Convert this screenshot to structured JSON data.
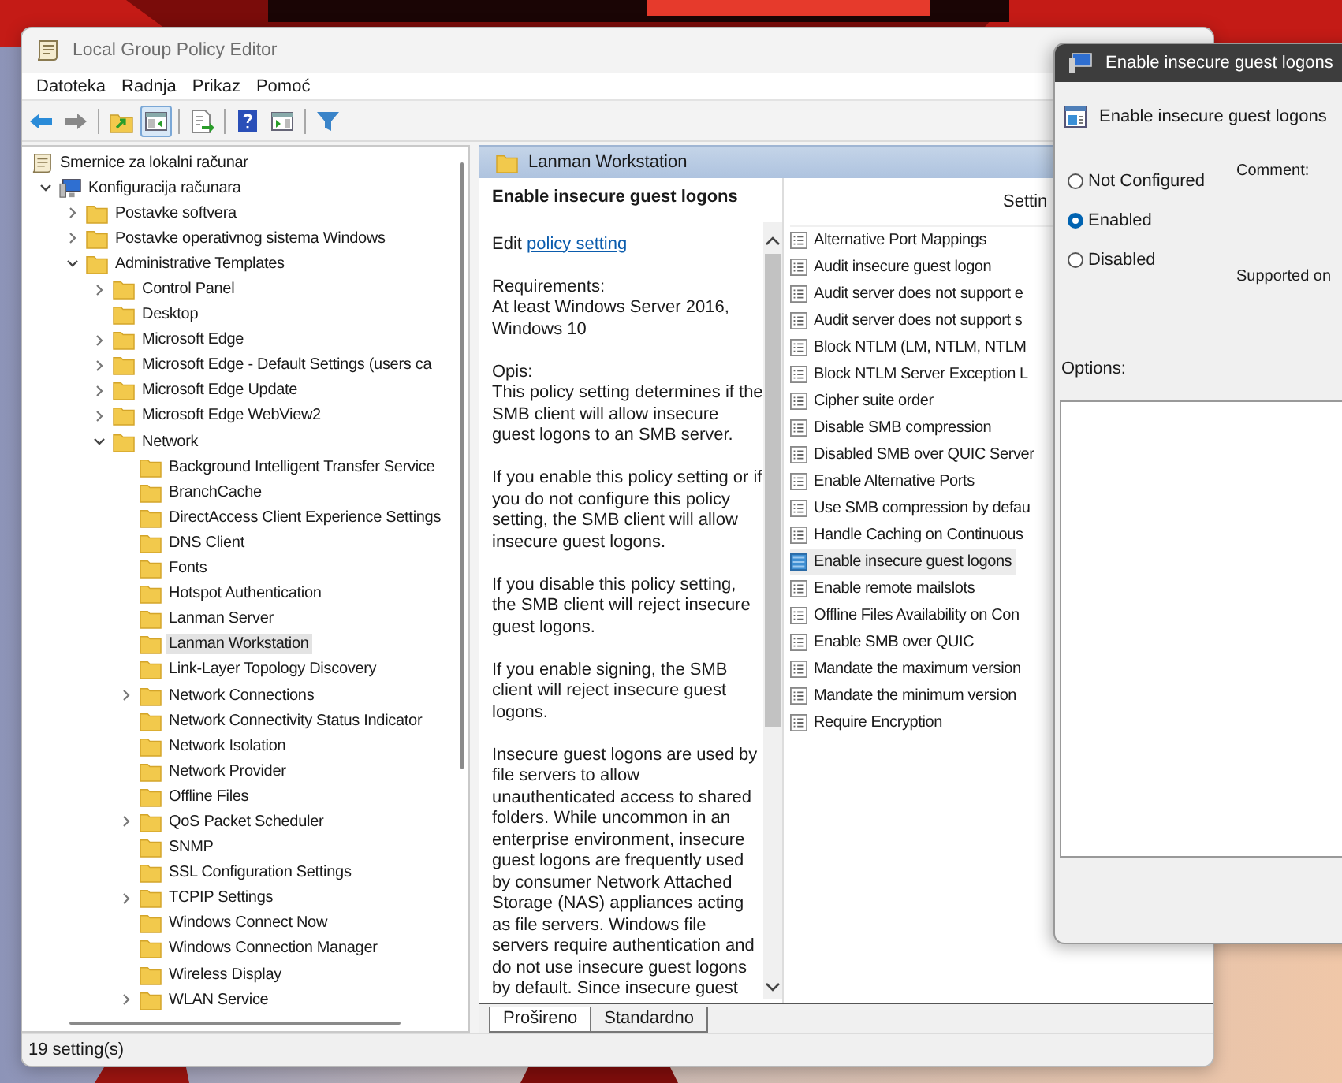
{
  "window": {
    "title": "Local Group Policy Editor"
  },
  "menu": [
    "Datoteka",
    "Radnja",
    "Prikaz",
    "Pomoć"
  ],
  "toolbar": [
    [
      {
        "kind": "back",
        "pressed": false
      },
      {
        "kind": "forward",
        "pressed": false
      }
    ],
    [
      {
        "kind": "up-folder",
        "pressed": false
      },
      {
        "kind": "show-tree",
        "pressed": true
      }
    ],
    [
      {
        "kind": "export",
        "pressed": false
      }
    ],
    [
      {
        "kind": "help",
        "pressed": false
      },
      {
        "kind": "action-pane",
        "pressed": false
      }
    ],
    [
      {
        "kind": "filter",
        "pressed": false
      }
    ]
  ],
  "tree": [
    {
      "label": "Smernice za lokalni računar",
      "kind": "policy-root",
      "selected": false,
      "children": [
        {
          "label": "Konfiguracija računara",
          "kind": "computer",
          "selected": false,
          "expanded": true,
          "children": [
            {
              "label": "Postavke softvera",
              "kind": "folder",
              "selected": false,
              "expanded": false
            },
            {
              "label": "Postavke operativnog sistema Windows",
              "kind": "folder",
              "selected": false,
              "expanded": false
            },
            {
              "label": "Administrative Templates",
              "kind": "folder",
              "selected": false,
              "expanded": true,
              "children": [
                {
                  "label": "Control Panel",
                  "kind": "folder",
                  "selected": false,
                  "expanded": false
                },
                {
                  "label": "Desktop",
                  "kind": "folder",
                  "selected": false
                },
                {
                  "label": "Microsoft Edge",
                  "kind": "folder",
                  "selected": false,
                  "expanded": false
                },
                {
                  "label": "Microsoft Edge - Default Settings (users ca",
                  "kind": "folder",
                  "selected": false,
                  "expanded": false
                },
                {
                  "label": "Microsoft Edge Update",
                  "kind": "folder",
                  "selected": false,
                  "expanded": false
                },
                {
                  "label": "Microsoft Edge WebView2",
                  "kind": "folder",
                  "selected": false,
                  "expanded": false
                },
                {
                  "label": "Network",
                  "kind": "folder",
                  "selected": false,
                  "expanded": true,
                  "children": [
                    {
                      "label": "Background Intelligent Transfer Service",
                      "kind": "folder",
                      "selected": false
                    },
                    {
                      "label": "BranchCache",
                      "kind": "folder",
                      "selected": false
                    },
                    {
                      "label": "DirectAccess Client Experience Settings",
                      "kind": "folder",
                      "selected": false
                    },
                    {
                      "label": "DNS Client",
                      "kind": "folder",
                      "selected": false
                    },
                    {
                      "label": "Fonts",
                      "kind": "folder",
                      "selected": false
                    },
                    {
                      "label": "Hotspot Authentication",
                      "kind": "folder",
                      "selected": false
                    },
                    {
                      "label": "Lanman Server",
                      "kind": "folder",
                      "selected": false
                    },
                    {
                      "label": "Lanman Workstation",
                      "kind": "folder",
                      "selected": true
                    },
                    {
                      "label": "Link-Layer Topology Discovery",
                      "kind": "folder",
                      "selected": false
                    },
                    {
                      "label": "Network Connections",
                      "kind": "folder",
                      "selected": false,
                      "expanded": false
                    },
                    {
                      "label": "Network Connectivity Status Indicator",
                      "kind": "folder",
                      "selected": false
                    },
                    {
                      "label": "Network Isolation",
                      "kind": "folder",
                      "selected": false
                    },
                    {
                      "label": "Network Provider",
                      "kind": "folder",
                      "selected": false
                    },
                    {
                      "label": "Offline Files",
                      "kind": "folder",
                      "selected": false
                    },
                    {
                      "label": "QoS Packet Scheduler",
                      "kind": "folder",
                      "selected": false,
                      "expanded": false
                    },
                    {
                      "label": "SNMP",
                      "kind": "folder",
                      "selected": false
                    },
                    {
                      "label": "SSL Configuration Settings",
                      "kind": "folder",
                      "selected": false
                    },
                    {
                      "label": "TCPIP Settings",
                      "kind": "folder",
                      "selected": false,
                      "expanded": false
                    },
                    {
                      "label": "Windows Connect Now",
                      "kind": "folder",
                      "selected": false
                    },
                    {
                      "label": "Windows Connection Manager",
                      "kind": "folder",
                      "selected": false
                    },
                    {
                      "label": "Wireless Display",
                      "kind": "folder",
                      "selected": false
                    },
                    {
                      "label": "WLAN Service",
                      "kind": "folder",
                      "selected": false,
                      "expanded": false
                    }
                  ]
                }
              ]
            }
          ]
        }
      ]
    }
  ],
  "details": {
    "header": "Lanman Workstation",
    "title": "Enable insecure guest logons",
    "edit_prefix": "Edit",
    "edit_link": "policy setting",
    "requirements_label": "Requirements:",
    "requirements": "At least Windows Server 2016, Windows 10",
    "description_label": "Opis:",
    "paragraphs": [
      "This policy setting determines if the SMB client will allow insecure guest logons to an SMB server.",
      "If you enable this policy setting or if you do not configure this policy setting, the SMB client will allow insecure guest logons.",
      "If you disable this policy setting, the SMB client will reject insecure guest logons.",
      "If you enable signing, the SMB client will reject insecure guest logons.",
      "Insecure guest logons are used by file servers to allow unauthenticated access to shared folders. While uncommon in an enterprise environment, insecure guest logons are frequently used by consumer Network Attached Storage (NAS) appliances acting as file servers. Windows file servers require authentication and do not use insecure guest logons by default. Since insecure guest"
    ]
  },
  "settings": {
    "column_header": "Settin",
    "items": [
      {
        "name": "Alternative Port Mappings",
        "selected": false
      },
      {
        "name": "Audit insecure guest logon",
        "selected": false
      },
      {
        "name": "Audit server does not support e",
        "selected": false
      },
      {
        "name": "Audit server does not support s",
        "selected": false
      },
      {
        "name": "Block NTLM (LM, NTLM, NTLM",
        "selected": false
      },
      {
        "name": "Block NTLM Server Exception L",
        "selected": false
      },
      {
        "name": "Cipher suite order",
        "selected": false
      },
      {
        "name": "Disable SMB compression",
        "selected": false
      },
      {
        "name": "Disabled SMB over QUIC Server",
        "selected": false
      },
      {
        "name": "Enable Alternative Ports",
        "selected": false
      },
      {
        "name": "Use SMB compression by defau",
        "selected": false
      },
      {
        "name": "Handle Caching on Continuous",
        "selected": false
      },
      {
        "name": "Enable insecure guest logons",
        "selected": true
      },
      {
        "name": "Enable remote mailslots",
        "selected": false
      },
      {
        "name": "Offline Files Availability on Con",
        "selected": false
      },
      {
        "name": "Enable SMB over QUIC",
        "selected": false
      },
      {
        "name": "Mandate the maximum version",
        "selected": false
      },
      {
        "name": "Mandate the minimum version",
        "selected": false
      },
      {
        "name": "Require Encryption",
        "selected": false
      }
    ]
  },
  "tabs": [
    {
      "label": "Prošireno",
      "selected": true
    },
    {
      "label": "Standardno",
      "selected": false
    }
  ],
  "status_bar": "19 setting(s)",
  "dialog": {
    "title": "Enable insecure guest logons",
    "policy_name": "Enable insecure guest logons",
    "options": [
      {
        "label": "Not Configured",
        "selected": false
      },
      {
        "label": "Enabled",
        "selected": true
      },
      {
        "label": "Disabled",
        "selected": false
      }
    ],
    "comment_label": "Comment:",
    "supported_label": "Supported on",
    "options_label": "Options:"
  }
}
